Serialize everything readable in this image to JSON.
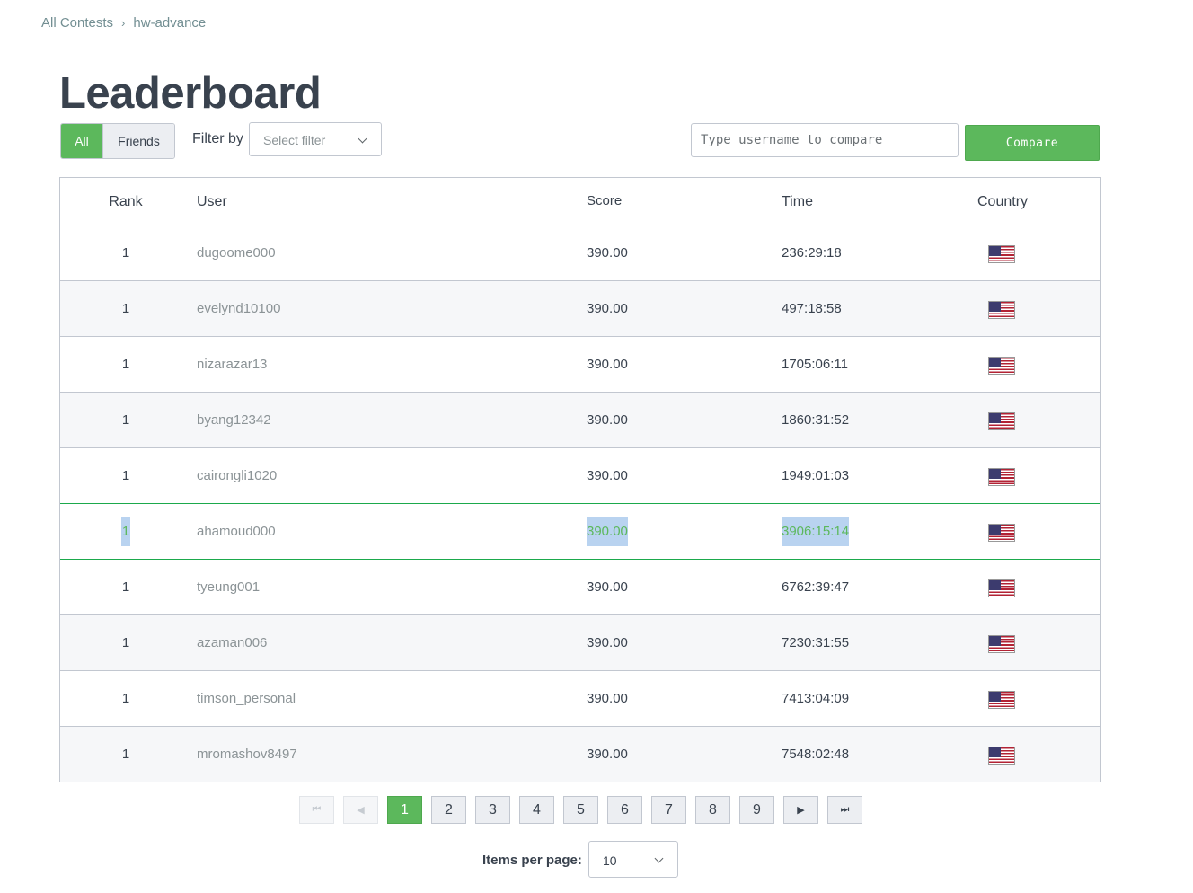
{
  "breadcrumb": {
    "items": [
      "All Contests",
      "hw-advance"
    ],
    "separator": "›"
  },
  "page_title": "Leaderboard",
  "filters": {
    "tabs": [
      "All",
      "Friends"
    ],
    "active_tab": "All",
    "filter_label": "Filter by",
    "filter_select_placeholder": "Select filter"
  },
  "compare": {
    "input_placeholder": "Type username to compare",
    "button_label": "Compare"
  },
  "table": {
    "columns": [
      "Rank",
      "User",
      "Score",
      "Time",
      "Country"
    ],
    "rows": [
      {
        "rank": "1",
        "user": "dugoome000",
        "score": "390.00",
        "time": "236:29:18",
        "country": "us-flag"
      },
      {
        "rank": "1",
        "user": "evelynd10100",
        "score": "390.00",
        "time": "497:18:58",
        "country": "us-flag"
      },
      {
        "rank": "1",
        "user": "nizarazar13",
        "score": "390.00",
        "time": "1705:06:11",
        "country": "us-flag"
      },
      {
        "rank": "1",
        "user": "byang12342",
        "score": "390.00",
        "time": "1860:31:52",
        "country": "us-flag"
      },
      {
        "rank": "1",
        "user": "cairongli1020",
        "score": "390.00",
        "time": "1949:01:03",
        "country": "us-flag"
      },
      {
        "rank": "1",
        "user": "ahamoud000",
        "score": "390.00",
        "time": "3906:15:14",
        "country": "us-flag",
        "selected": true
      },
      {
        "rank": "1",
        "user": "tyeung001",
        "score": "390.00",
        "time": "6762:39:47",
        "country": "us-flag"
      },
      {
        "rank": "1",
        "user": "azaman006",
        "score": "390.00",
        "time": "7230:31:55",
        "country": "us-flag"
      },
      {
        "rank": "1",
        "user": "timson_personal",
        "score": "390.00",
        "time": "7413:04:09",
        "country": "us-flag"
      },
      {
        "rank": "1",
        "user": "mromashov8497",
        "score": "390.00",
        "time": "7548:02:48",
        "country": "us-flag"
      }
    ]
  },
  "pagination": {
    "pages": [
      "1",
      "2",
      "3",
      "4",
      "5",
      "6",
      "7",
      "8",
      "9"
    ],
    "current_page": "1",
    "first_icon": "⏮",
    "prev_icon": "◀",
    "next_icon": "▶",
    "last_icon": "⏭"
  },
  "items_per_page": {
    "label": "Items per page:",
    "value": "10"
  },
  "colors": {
    "accent_green": "#5cb85c",
    "selection_highlight": "#b9d3f0",
    "selected_row_border": "#1ba94c"
  }
}
